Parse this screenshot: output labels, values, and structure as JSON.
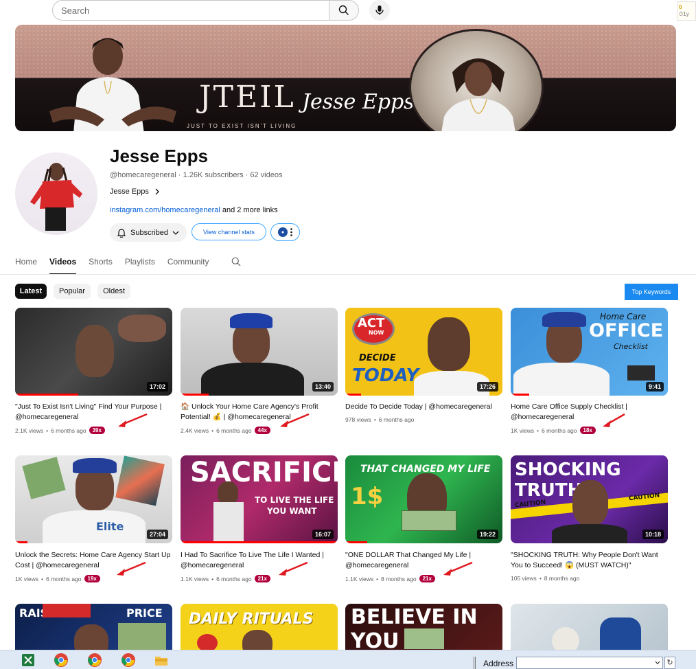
{
  "search": {
    "placeholder": "Search"
  },
  "extension": {
    "count": "0",
    "age": "1y"
  },
  "banner": {
    "brand": "JTEIL",
    "script": "Jesse Epps",
    "tagline": "JUST TO EXIST ISN'T LIVING"
  },
  "channel": {
    "name": "Jesse Epps",
    "handle": "@homecaregeneral",
    "subscribers": "1.26K subscribers",
    "videos": "62 videos",
    "description": "Jesse Epps",
    "link": "instagram.com/homecaregeneral",
    "more_links": "and 2 more links",
    "subscribed_label": "Subscribed",
    "stats_label": "View channel stats"
  },
  "tabs": [
    "Home",
    "Videos",
    "Shorts",
    "Playlists",
    "Community"
  ],
  "chips": [
    "Latest",
    "Popular",
    "Oldest"
  ],
  "top_keywords": "Top Keywords",
  "videos": [
    {
      "title": "\"Just To Exist Isn't Living\" Find Your Purpose | @homecaregeneral",
      "views": "2.1K views",
      "age": "6 months ago",
      "mult": "39x",
      "duration": "17:02"
    },
    {
      "title": "🏠 Unlock Your Home Care Agency's Profit Potential! 💰 | @homecaregeneral",
      "views": "2.4K views",
      "age": "6 months ago",
      "mult": "44x",
      "duration": "13:40"
    },
    {
      "title": "Decide To Decide Today | @homecaregeneral",
      "views": "978 views",
      "age": "6 months ago",
      "mult": "",
      "duration": "17:26",
      "thumb_text": {
        "act": "ACT",
        "now": "NOW",
        "decide": "DECIDE",
        "today": "TODAY"
      }
    },
    {
      "title": "Home Care Office Supply Checklist | @homecaregeneral",
      "views": "1K views",
      "age": "6 months ago",
      "mult": "18x",
      "duration": "9:41",
      "thumb_text": {
        "l1": "Home Care",
        "l2": "OFFICE",
        "l3": "Checklist"
      }
    },
    {
      "title": "Unlock the Secrets: Home Care Agency Start Up Cost | @homecaregeneral",
      "views": "1K views",
      "age": "6 months ago",
      "mult": "19x",
      "duration": "27:04",
      "thumb_text": {
        "l1": "Elite"
      }
    },
    {
      "title": "I Had To Sacrifice To Live The Life I Wanted | @homecaregeneral",
      "views": "1.1K views",
      "age": "6 months ago",
      "mult": "21x",
      "duration": "16:07",
      "thumb_text": {
        "l1": "SACRIFICE",
        "l2": "TO LIVE THE LIFE",
        "l3": "YOU WANT"
      }
    },
    {
      "title": "\"ONE DOLLAR That Changed My Life | @homecaregeneral",
      "views": "1.1K views",
      "age": "8 months ago",
      "mult": "21x",
      "duration": "19:22",
      "thumb_text": {
        "l1": "THAT CHANGED MY LIFE",
        "l2": "1$"
      }
    },
    {
      "title": "\"SHOCKING TRUTH: Why People Don't Want You to Succeed! 😱 (MUST WATCH)\"",
      "views": "105 views",
      "age": "8 months ago",
      "mult": "",
      "duration": "10:18",
      "thumb_text": {
        "l1": "SHOCKING TRUTH",
        "l2": "CAUTION"
      }
    }
  ],
  "bottom_thumbs": {
    "t1": {
      "l1": "RAISE",
      "l2": "PRICE"
    },
    "t2": {
      "l1": "DAILY RITUALS"
    },
    "t3": {
      "l1": "BELIEVE IN YOU"
    }
  },
  "taskbar": {
    "address_label": "Address",
    "go": "↻"
  },
  "colors": {
    "accent": "#065fd4",
    "badge": "#b2003d",
    "keyword_button": "#1a8af0"
  }
}
